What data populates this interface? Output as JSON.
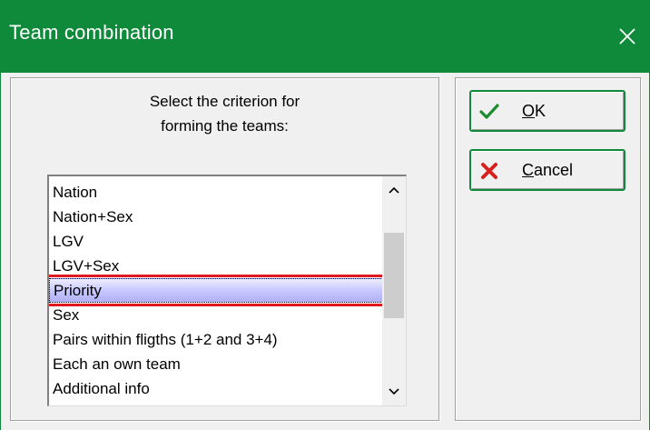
{
  "window": {
    "title": "Team combination",
    "title_bar_color": "#0e8a3a",
    "close_icon": "close-icon"
  },
  "prompt": {
    "line1": "Select the criterion for",
    "line2": "forming the teams:"
  },
  "criteria": {
    "items": [
      "Nation",
      "Nation+Sex",
      "LGV",
      "LGV+Sex",
      "Priority",
      "Sex",
      "Pairs within fligths (1+2 and 3+4)",
      "Each an own team",
      "Additional info"
    ],
    "selected": "Priority",
    "highlight_color": "#e01820"
  },
  "buttons": {
    "ok": {
      "label": "OK",
      "underline": "O",
      "rest": "K",
      "icon": "check-icon"
    },
    "cancel": {
      "label": "Cancel",
      "underline": "C",
      "rest": "ancel",
      "icon": "x-icon"
    }
  }
}
